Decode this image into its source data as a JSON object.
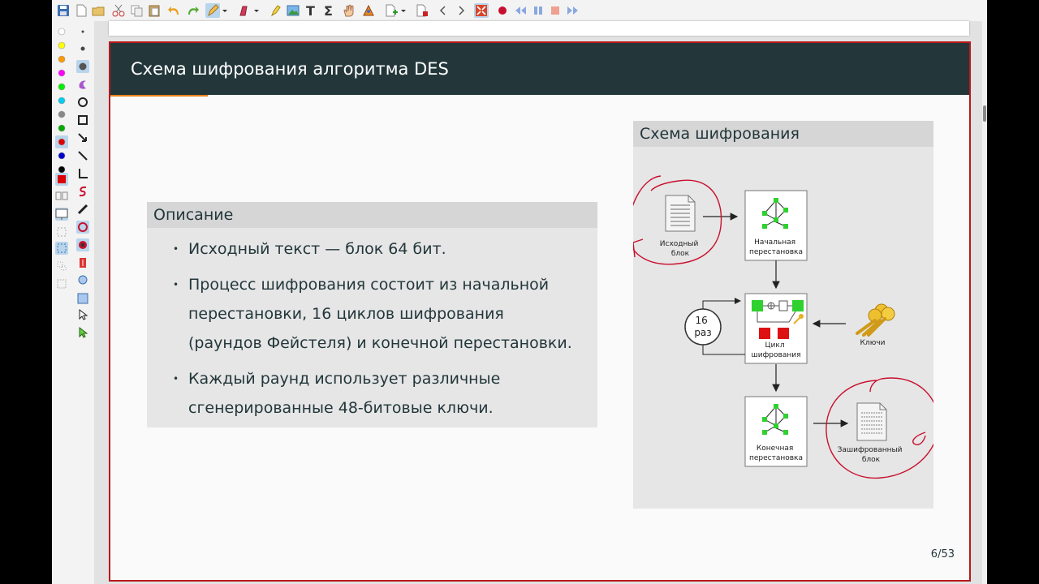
{
  "slide": {
    "title": "Схема шифрования алгоритма DES",
    "page_number": "6/53"
  },
  "description": {
    "heading": "Описание",
    "items": [
      "Исходный текст — блок 64 бит.",
      "Процесс шифрования состоит из начальной перестановки, 16 циклов шифрования (раундов Фейстеля) и конечной перестановки.",
      "Каждый раунд использует различные сгенерированные 48-битовые ключи."
    ]
  },
  "scheme": {
    "heading": "Схема шифрования",
    "source_block": [
      "Исходный",
      "блок"
    ],
    "initial_permutation": [
      "Начальная",
      "перестановка"
    ],
    "cipher_cycle": [
      "Цикл",
      "шифрования"
    ],
    "rounds": [
      "16",
      "раз"
    ],
    "keys": "Ключи",
    "final_permutation": [
      "Конечная",
      "перестановка"
    ],
    "encrypted_block": [
      "Зашифрованный",
      "блок"
    ]
  },
  "colors": {
    "titlebar": "#23373b",
    "accent": "#eb811b",
    "slide_border": "#b8191c",
    "annotation": "#c8102e"
  },
  "toolbar_icons": [
    "save-icon",
    "new-page-icon",
    "open-icon",
    "cut-icon",
    "copy-icon",
    "paste-icon",
    "undo-icon",
    "redo-icon",
    "pen-icon",
    "eraser-icon",
    "highlighter-icon",
    "image-icon",
    "text-icon",
    "formula-icon",
    "hand-icon",
    "select-icon",
    "add-page-icon",
    "delete-page-icon",
    "previous-icon",
    "next-icon",
    "fullscreen-icon",
    "record-icon",
    "rewind-icon",
    "pause-icon",
    "stop-icon",
    "fast-forward-icon"
  ],
  "palette": [
    "#ffffff",
    "#ffff00",
    "#ff9900",
    "#ff00ff",
    "#00ee00",
    "#00ccee",
    "#888888",
    "#00aa00",
    "#dd0000",
    "#0000cc",
    "#000000",
    "#dd0000"
  ]
}
